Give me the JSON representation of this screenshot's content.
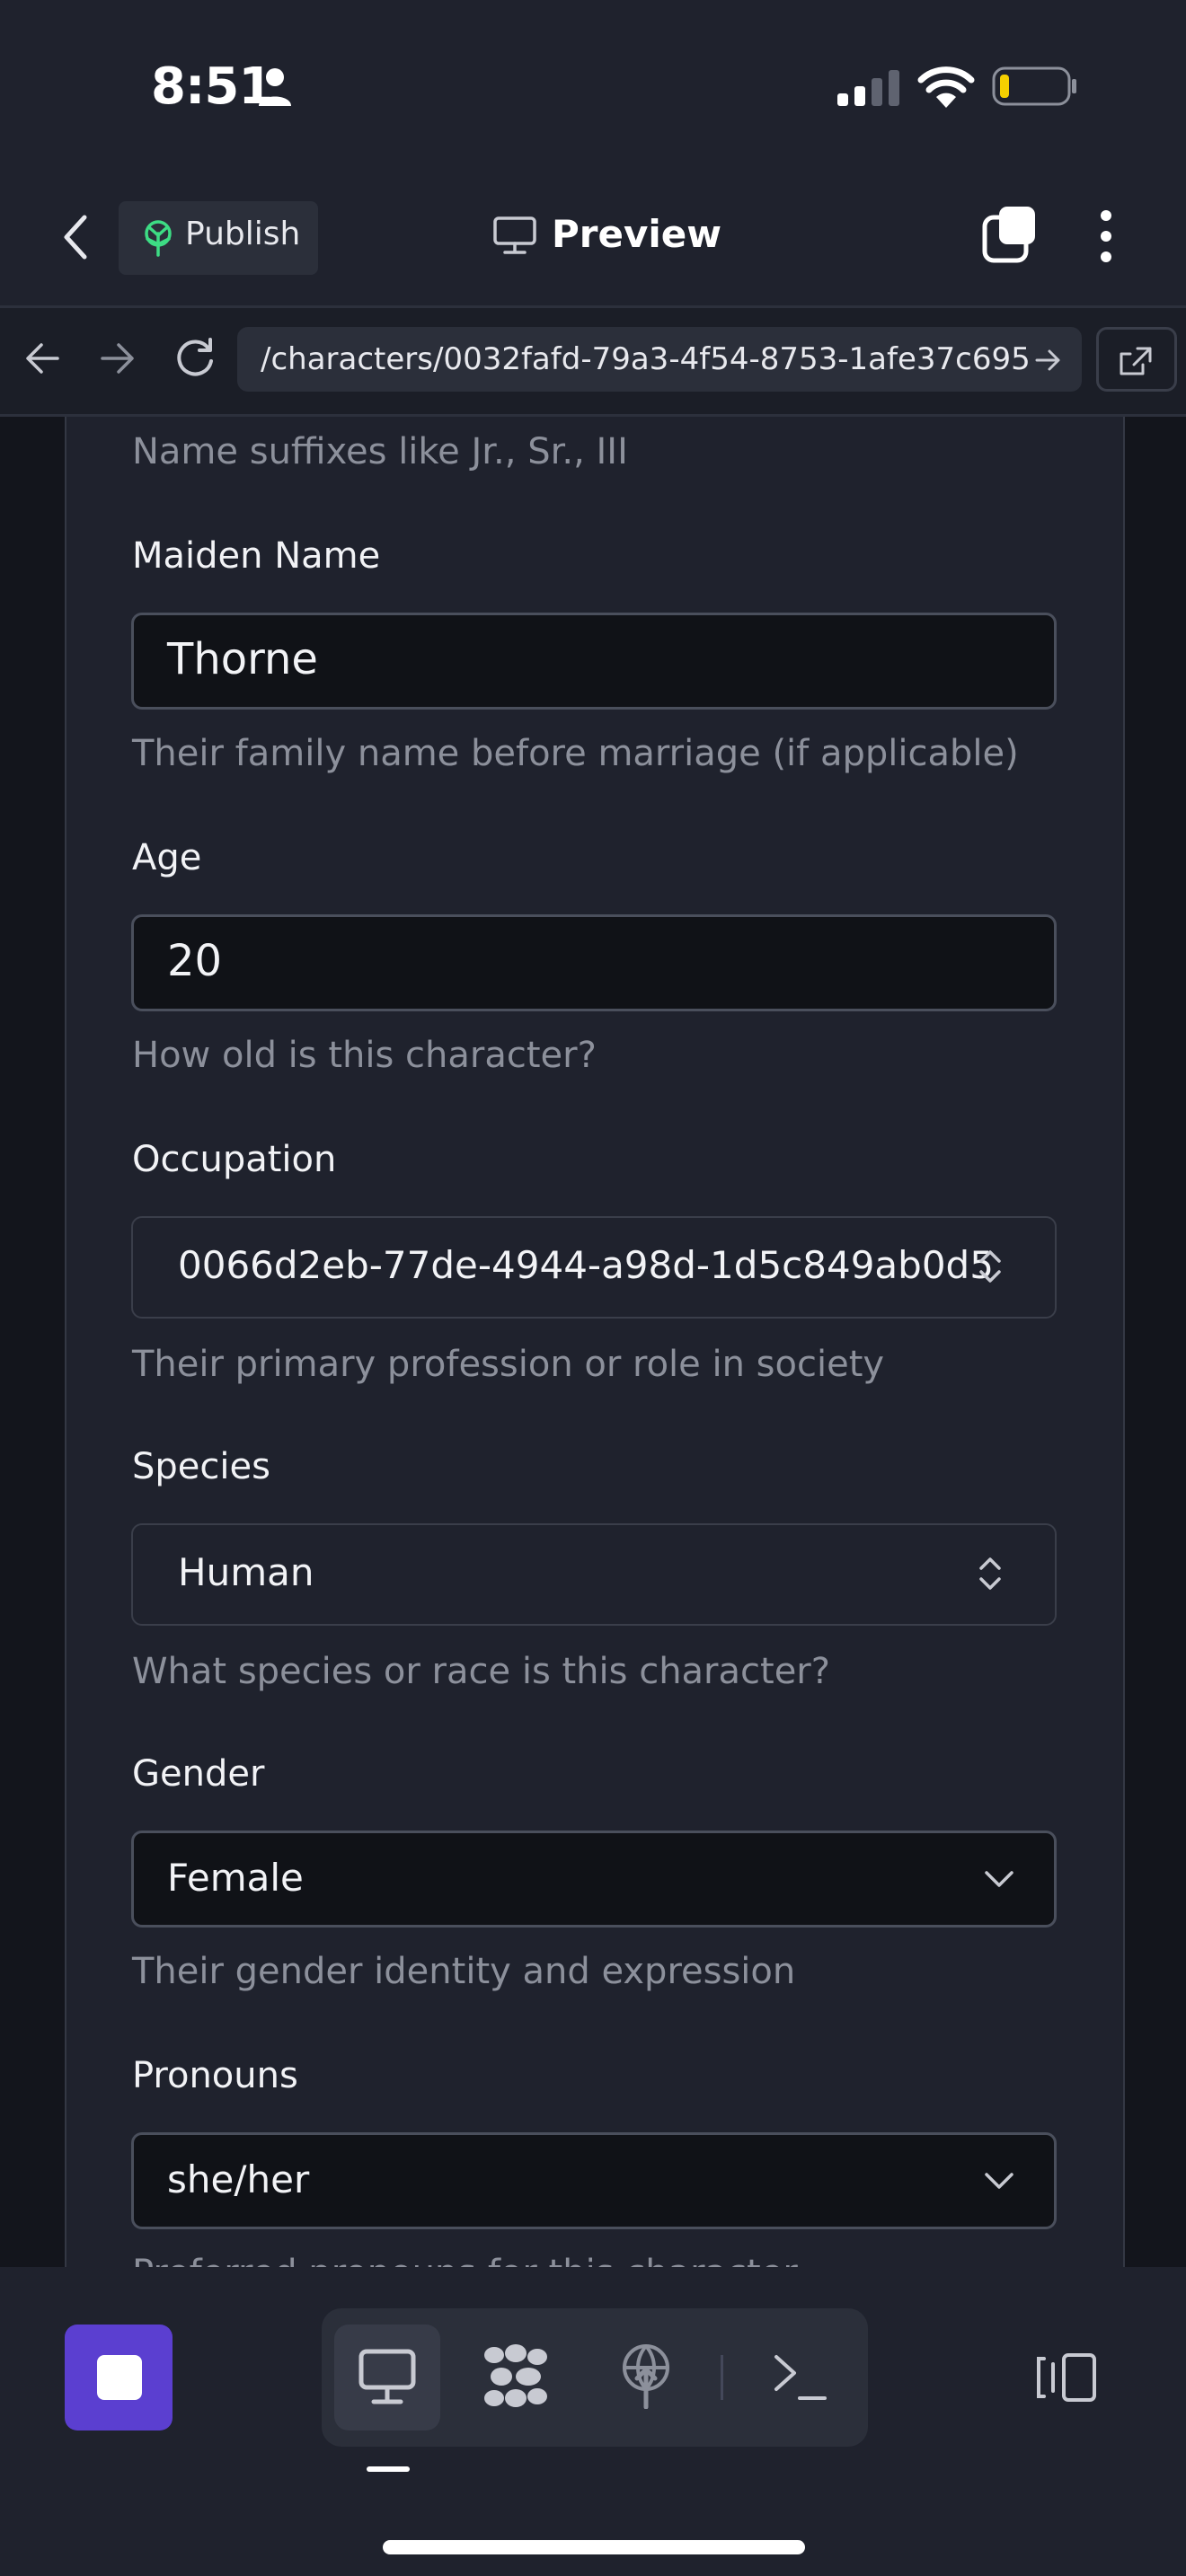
{
  "status": {
    "time": "8:51",
    "icons": [
      "person-icon",
      "signal-icon",
      "wifi-icon",
      "battery-icon"
    ]
  },
  "topnav": {
    "publish_label": "Publish",
    "preview_label": "Preview",
    "icons": [
      "back-icon",
      "publish-icon",
      "monitor-icon",
      "tabs-icon",
      "more-icon"
    ]
  },
  "browser": {
    "url": "/characters/0032fafd-79a3-4f54-8753-1afe37c695",
    "icons": [
      "nav-back-icon",
      "nav-forward-icon",
      "reload-icon",
      "url-go-icon",
      "external-link-icon"
    ]
  },
  "form": {
    "suffix_hint": "Name suffixes like Jr., Sr., III",
    "maiden": {
      "label": "Maiden Name",
      "value": "Thorne",
      "hint": "Their family name before marriage (if applicable)"
    },
    "age": {
      "label": "Age",
      "value": "20",
      "hint": "How old is this character?"
    },
    "occupation": {
      "label": "Occupation",
      "value": "0066d2eb-77de-4944-a98d-1d5c849ab0d5",
      "hint": "Their primary profession or role in society"
    },
    "species": {
      "label": "Species",
      "value": "Human",
      "hint": "What species or race is this character?"
    },
    "gender": {
      "label": "Gender",
      "value": "Female",
      "hint": "Their gender identity and expression"
    },
    "pronouns": {
      "label": "Pronouns",
      "value": "she/her",
      "hint": "Preferred pronouns for this character"
    }
  },
  "toolbar": {
    "icons": [
      "stop-icon",
      "desktop-icon",
      "cluster-icon",
      "deploy-icon",
      "terminal-icon",
      "panel-icon"
    ]
  },
  "colors": {
    "background": "#1f222d",
    "accent": "#5b3fd0",
    "publish_icon": "#3ddc84",
    "battery_low": "#f5d000"
  }
}
